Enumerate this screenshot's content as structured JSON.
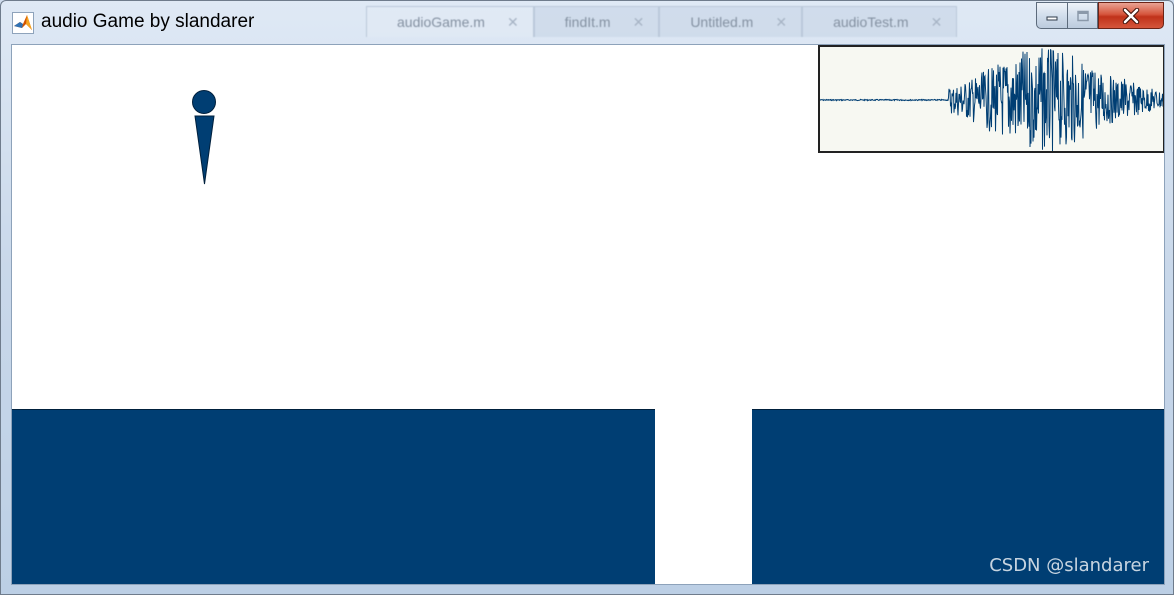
{
  "window": {
    "title": "audio Game by slandarer",
    "background_tabs": [
      "audioGame.m",
      "findIt.m",
      "Untitled.m",
      "audioTest.m"
    ]
  },
  "game": {
    "player_color": "#003e73",
    "ground_color": "#003e73",
    "background_color": "#ffffff",
    "waveform_color": "#003e73",
    "waveform_bg_color": "#f7f8f2"
  },
  "watermark": "CSDN @slandarer"
}
